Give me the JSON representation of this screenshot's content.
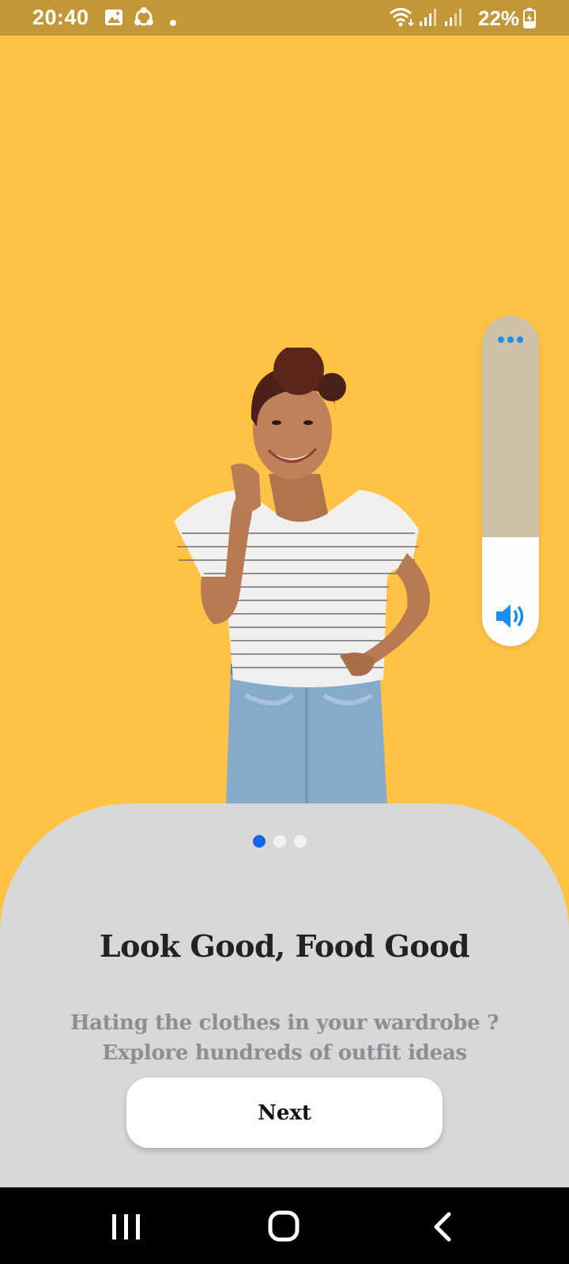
{
  "status_bar": {
    "time": "20:40",
    "battery": "22%",
    "icons": [
      "image-icon",
      "sync-icon",
      "notification-dot-icon",
      "wifi-icon",
      "signal-icon",
      "signal-icon",
      "battery-charging-icon"
    ]
  },
  "volume_panel": {
    "level": 0.33,
    "icons": [
      "more-icon",
      "speaker-icon"
    ]
  },
  "pager": {
    "total": 3,
    "active": 0,
    "active_color": "#1565E8",
    "inactive_color": "#F2F2F2"
  },
  "onboarding": {
    "title": "Look Good, Food Good",
    "subtitle_line1": "Hating the clothes in your wardrobe ?",
    "subtitle_line2": "Explore hundreds of outfit ideas",
    "next_label": "Next"
  },
  "nav_bar": {
    "buttons": [
      "recent-apps-icon",
      "home-icon",
      "back-icon"
    ]
  },
  "colors": {
    "hero_background": "#FFC244",
    "status_bar": "#C39636",
    "sheet": "#D8D8D8",
    "accent_blue": "#1B8CF2"
  }
}
